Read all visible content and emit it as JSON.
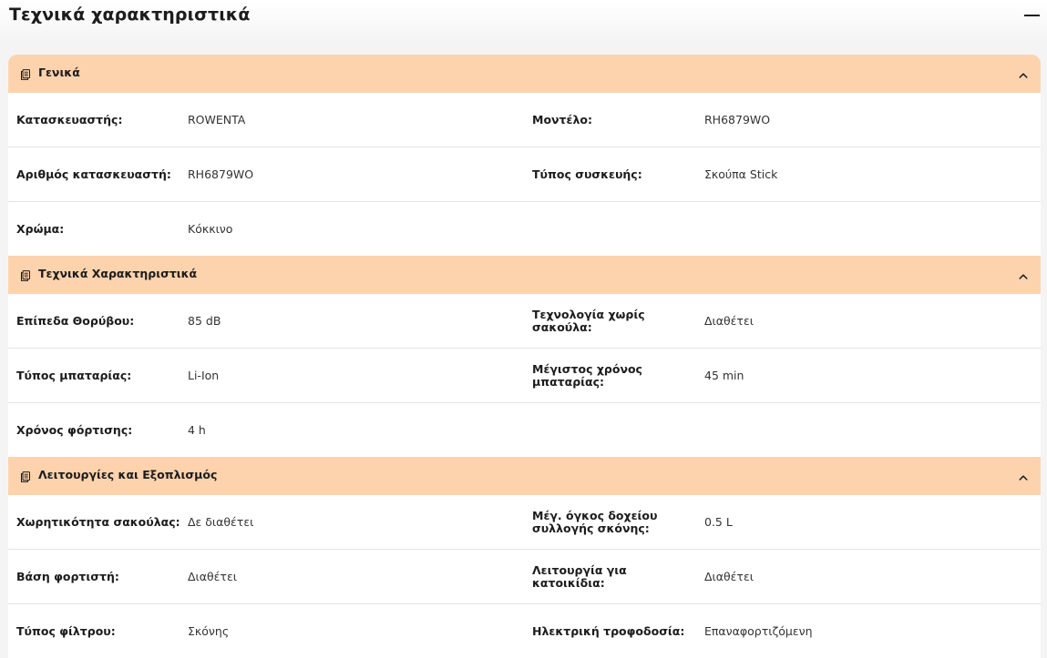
{
  "page": {
    "title": "Τεχνικά χαρακτηριστικά"
  },
  "colors": {
    "section_header_bg": "#fdd3ad",
    "card_bg": "#ffffff",
    "page_bg": "#f4f4f5"
  },
  "sections": [
    {
      "title": "Γενικά",
      "rows": [
        [
          {
            "label": "Κατασκευαστής:",
            "value": "ROWENTA"
          },
          {
            "label": "Μοντέλο:",
            "value": "RH6879WO"
          }
        ],
        [
          {
            "label": "Αριθμός κατασκευαστή:",
            "value": "RH6879WO"
          },
          {
            "label": "Τύπος συσκευής:",
            "value": "Σκούπα Stick"
          }
        ],
        [
          {
            "label": "Χρώμα:",
            "value": "Κόκκινο"
          }
        ]
      ]
    },
    {
      "title": "Τεχνικά Χαρακτηριστικά",
      "rows": [
        [
          {
            "label": "Επίπεδα Θορύβου:",
            "value": "85 dB"
          },
          {
            "label": "Τεχνολογία χωρίς σακούλα:",
            "value": "Διαθέτει"
          }
        ],
        [
          {
            "label": "Τύπος μπαταρίας:",
            "value": "Li-Ion"
          },
          {
            "label": "Μέγιστος χρόνος μπαταρίας:",
            "value": "45 min"
          }
        ],
        [
          {
            "label": "Χρόνος φόρτισης:",
            "value": "4 h"
          }
        ]
      ]
    },
    {
      "title": "Λειτουργίες και Εξοπλισμός",
      "rows": [
        [
          {
            "label": "Χωρητικότητα σακούλας:",
            "value": "Δε διαθέτει"
          },
          {
            "label": "Μέγ. όγκος δοχείου συλλογής σκόνης:",
            "value": "0.5 L"
          }
        ],
        [
          {
            "label": "Βάση φορτιστή:",
            "value": "Διαθέτει"
          },
          {
            "label": "Λειτουργία για κατοικίδια:",
            "value": "Διαθέτει"
          }
        ],
        [
          {
            "label": "Τύπος φίλτρου:",
            "value": "Σκόνης"
          },
          {
            "label": "Ηλεκτρική τροφοδοσία:",
            "value": "Επαναφορτιζόμενη"
          }
        ]
      ]
    }
  ]
}
